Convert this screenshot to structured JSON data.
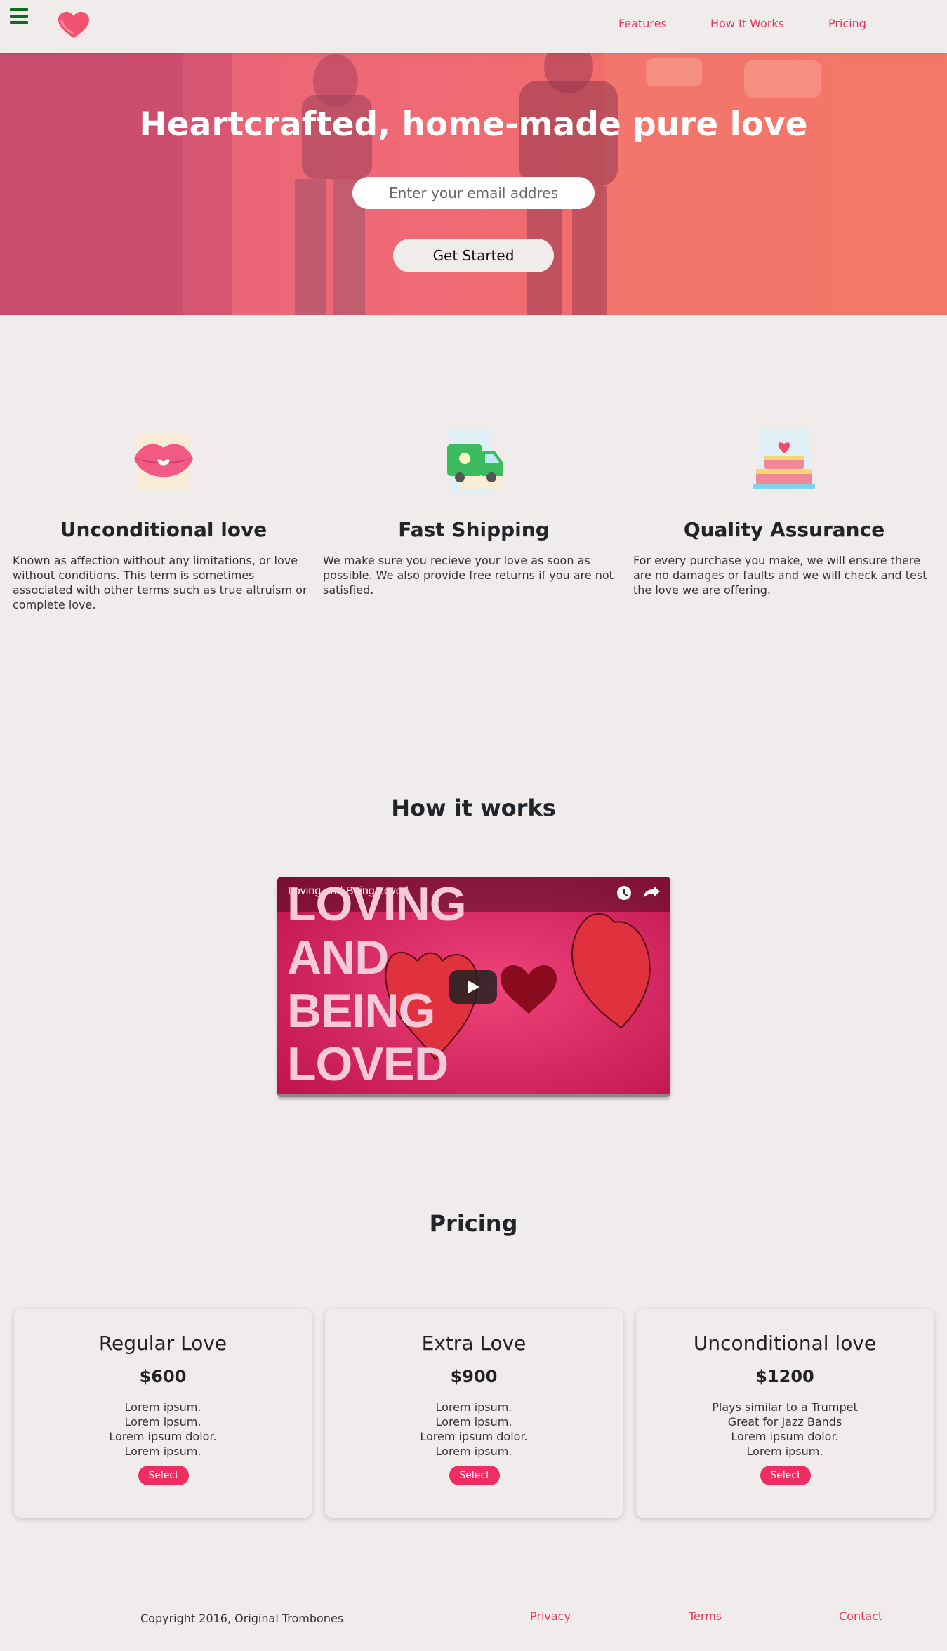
{
  "header": {
    "nav": [
      {
        "label": "Features"
      },
      {
        "label": "How It Works"
      },
      {
        "label": "Pricing"
      }
    ]
  },
  "hero": {
    "title": "Heartcrafted, home-made pure love",
    "email_placeholder": "Enter your email addres",
    "cta_label": "Get Started"
  },
  "features": [
    {
      "icon": "lips-icon",
      "title": "Unconditional love",
      "text": "Known as affection without any limitations, or love without conditions. This term is sometimes associated with other terms such as true altruism or complete love."
    },
    {
      "icon": "delivery-van-icon",
      "title": "Fast Shipping",
      "text": "We make sure you recieve your love as soon as possible. We also provide free returns if you are not satisfied."
    },
    {
      "icon": "cake-icon",
      "title": "Quality Assurance",
      "text": "For every purchase you make, we will ensure there are no damages or faults and we will check and test the love we are offering."
    }
  ],
  "how_it_works": {
    "title": "How it works",
    "video": {
      "title": "Loving and Being Loved",
      "big_text": [
        "LOVING",
        "AND",
        "BEING",
        "LOVED"
      ]
    }
  },
  "pricing": {
    "title": "Pricing",
    "plans": [
      {
        "name": "Regular Love",
        "price": "$600",
        "features": [
          "Lorem ipsum.",
          "Lorem ipsum.",
          "Lorem ipsum dolor.",
          "Lorem ipsum."
        ],
        "button": "Select"
      },
      {
        "name": "Extra Love",
        "price": "$900",
        "features": [
          "Lorem ipsum.",
          "Lorem ipsum.",
          "Lorem ipsum dolor.",
          "Lorem ipsum."
        ],
        "button": "Select"
      },
      {
        "name": "Unconditional love",
        "price": "$1200",
        "features": [
          "Plays similar to a Trumpet",
          "Great for Jazz Bands",
          "Lorem ipsum dolor.",
          "Lorem ipsum."
        ],
        "button": "Select"
      }
    ]
  },
  "footer": {
    "copyright": "Copyright 2016, Original Trombones",
    "links": [
      {
        "label": "Privacy"
      },
      {
        "label": "Terms"
      },
      {
        "label": "Contact"
      }
    ]
  },
  "colors": {
    "accent": "#e8365d",
    "button": "#ef2d63",
    "background": "#f0ecec",
    "hamburger": "#0e6b1f"
  }
}
